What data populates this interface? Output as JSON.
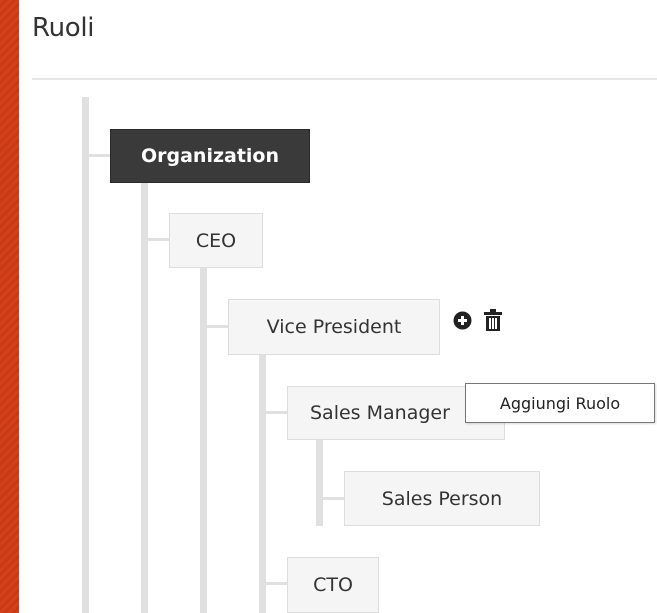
{
  "page": {
    "title": "Ruoli"
  },
  "tree": {
    "root": {
      "label": "Organization"
    },
    "ceo": {
      "label": "CEO"
    },
    "vice_president": {
      "label": "Vice President"
    },
    "sales_manager": {
      "label": "Sales Manager"
    },
    "sales_person": {
      "label": "Sales Person"
    },
    "cto": {
      "label": "CTO"
    }
  },
  "actions": {
    "add_icon": "plus-circle-icon",
    "delete_icon": "trash-icon"
  },
  "tooltip": {
    "text": "Aggiungi Ruolo"
  },
  "colors": {
    "background": "#d4401c",
    "root_node_bg": "#3a3a3a",
    "node_bg": "#f5f5f5",
    "connector": "#e0e0e0"
  }
}
